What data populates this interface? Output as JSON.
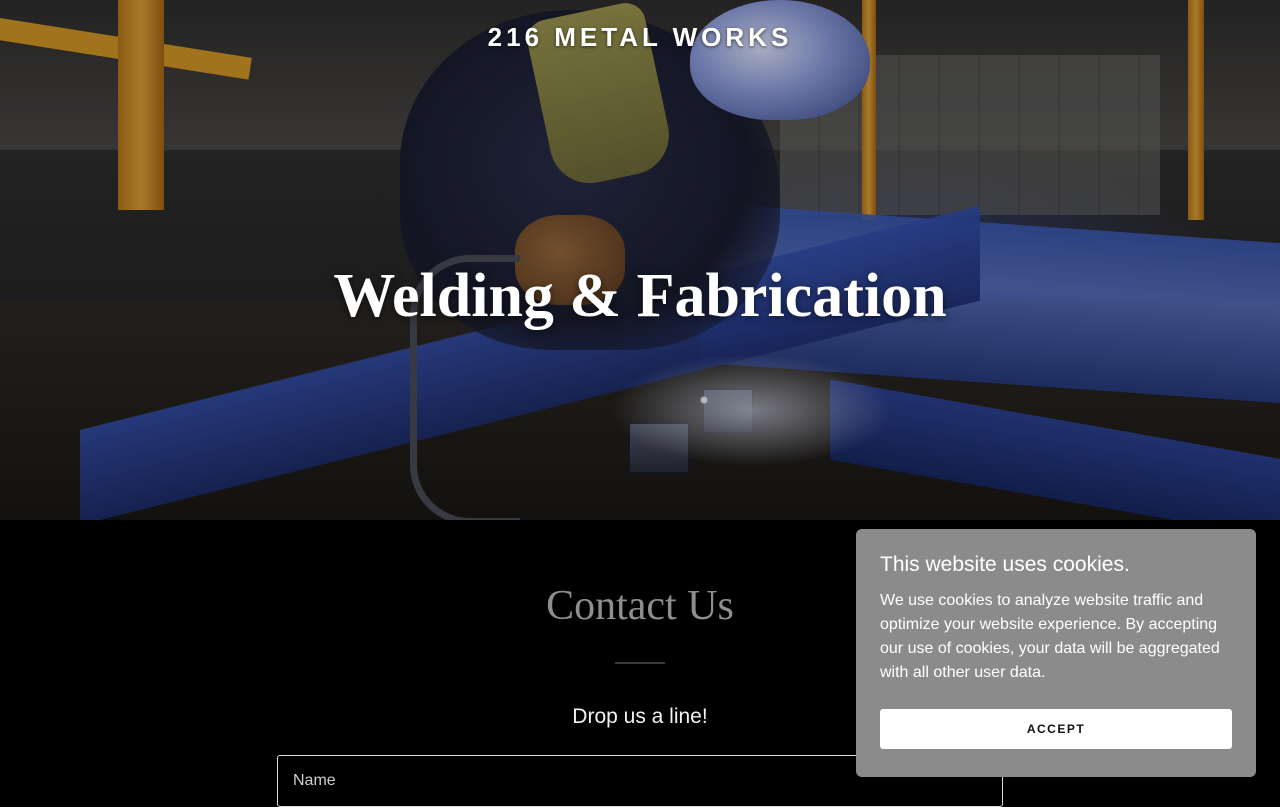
{
  "header": {
    "brand": "216 METAL WORKS"
  },
  "hero": {
    "title": "Welding & Fabrication",
    "image": "welder-at-work-photo"
  },
  "contact": {
    "title": "Contact Us",
    "subtitle": "Drop us a line!",
    "name_placeholder": "Name"
  },
  "cookie_banner": {
    "title": "This website uses cookies.",
    "text": "We use cookies to analyze website traffic and optimize your website experience. By accepting our use of cookies, your data will be aggregated with all other user data.",
    "accept_label": "ACCEPT"
  }
}
